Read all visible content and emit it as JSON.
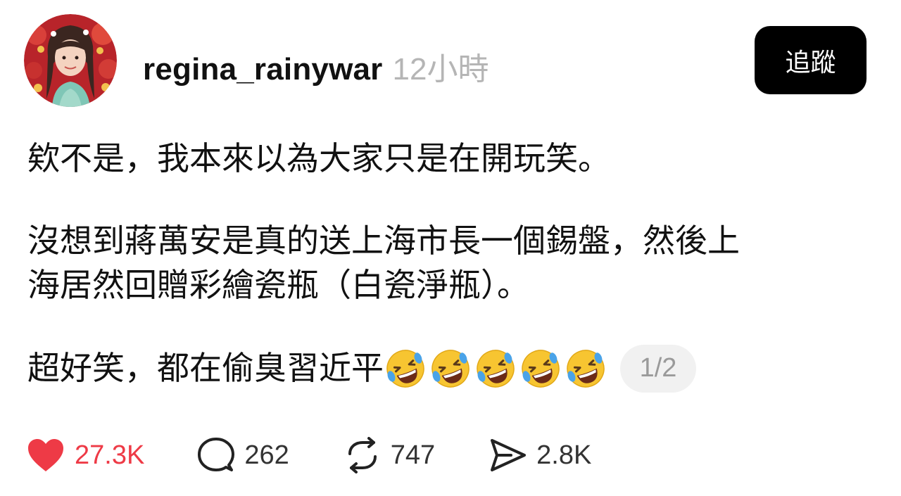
{
  "header": {
    "username": "regina_rainywar",
    "time": "12小時",
    "follow_label": "追蹤"
  },
  "post": {
    "paragraph1": "欸不是，我本來以為大家只是在開玩笑。",
    "paragraph2_line1": "沒想到蔣萬安是真的送上海市長一個錫盤，然後上",
    "paragraph2_line2": "海居然回贈彩繪瓷瓶（白瓷淨瓶）。",
    "paragraph3_text": "超好笑，都在偷臭習近平",
    "emoji_name": "rolling-on-the-floor-laughing",
    "emoji_count": 5,
    "page_indicator": "1/2"
  },
  "actions": {
    "likes": "27.3K",
    "comments": "262",
    "reposts": "747",
    "shares": "2.8K"
  },
  "colors": {
    "like_red": "#ee3a46",
    "follow_bg": "#000000",
    "time_gray": "#b5b5b5"
  }
}
